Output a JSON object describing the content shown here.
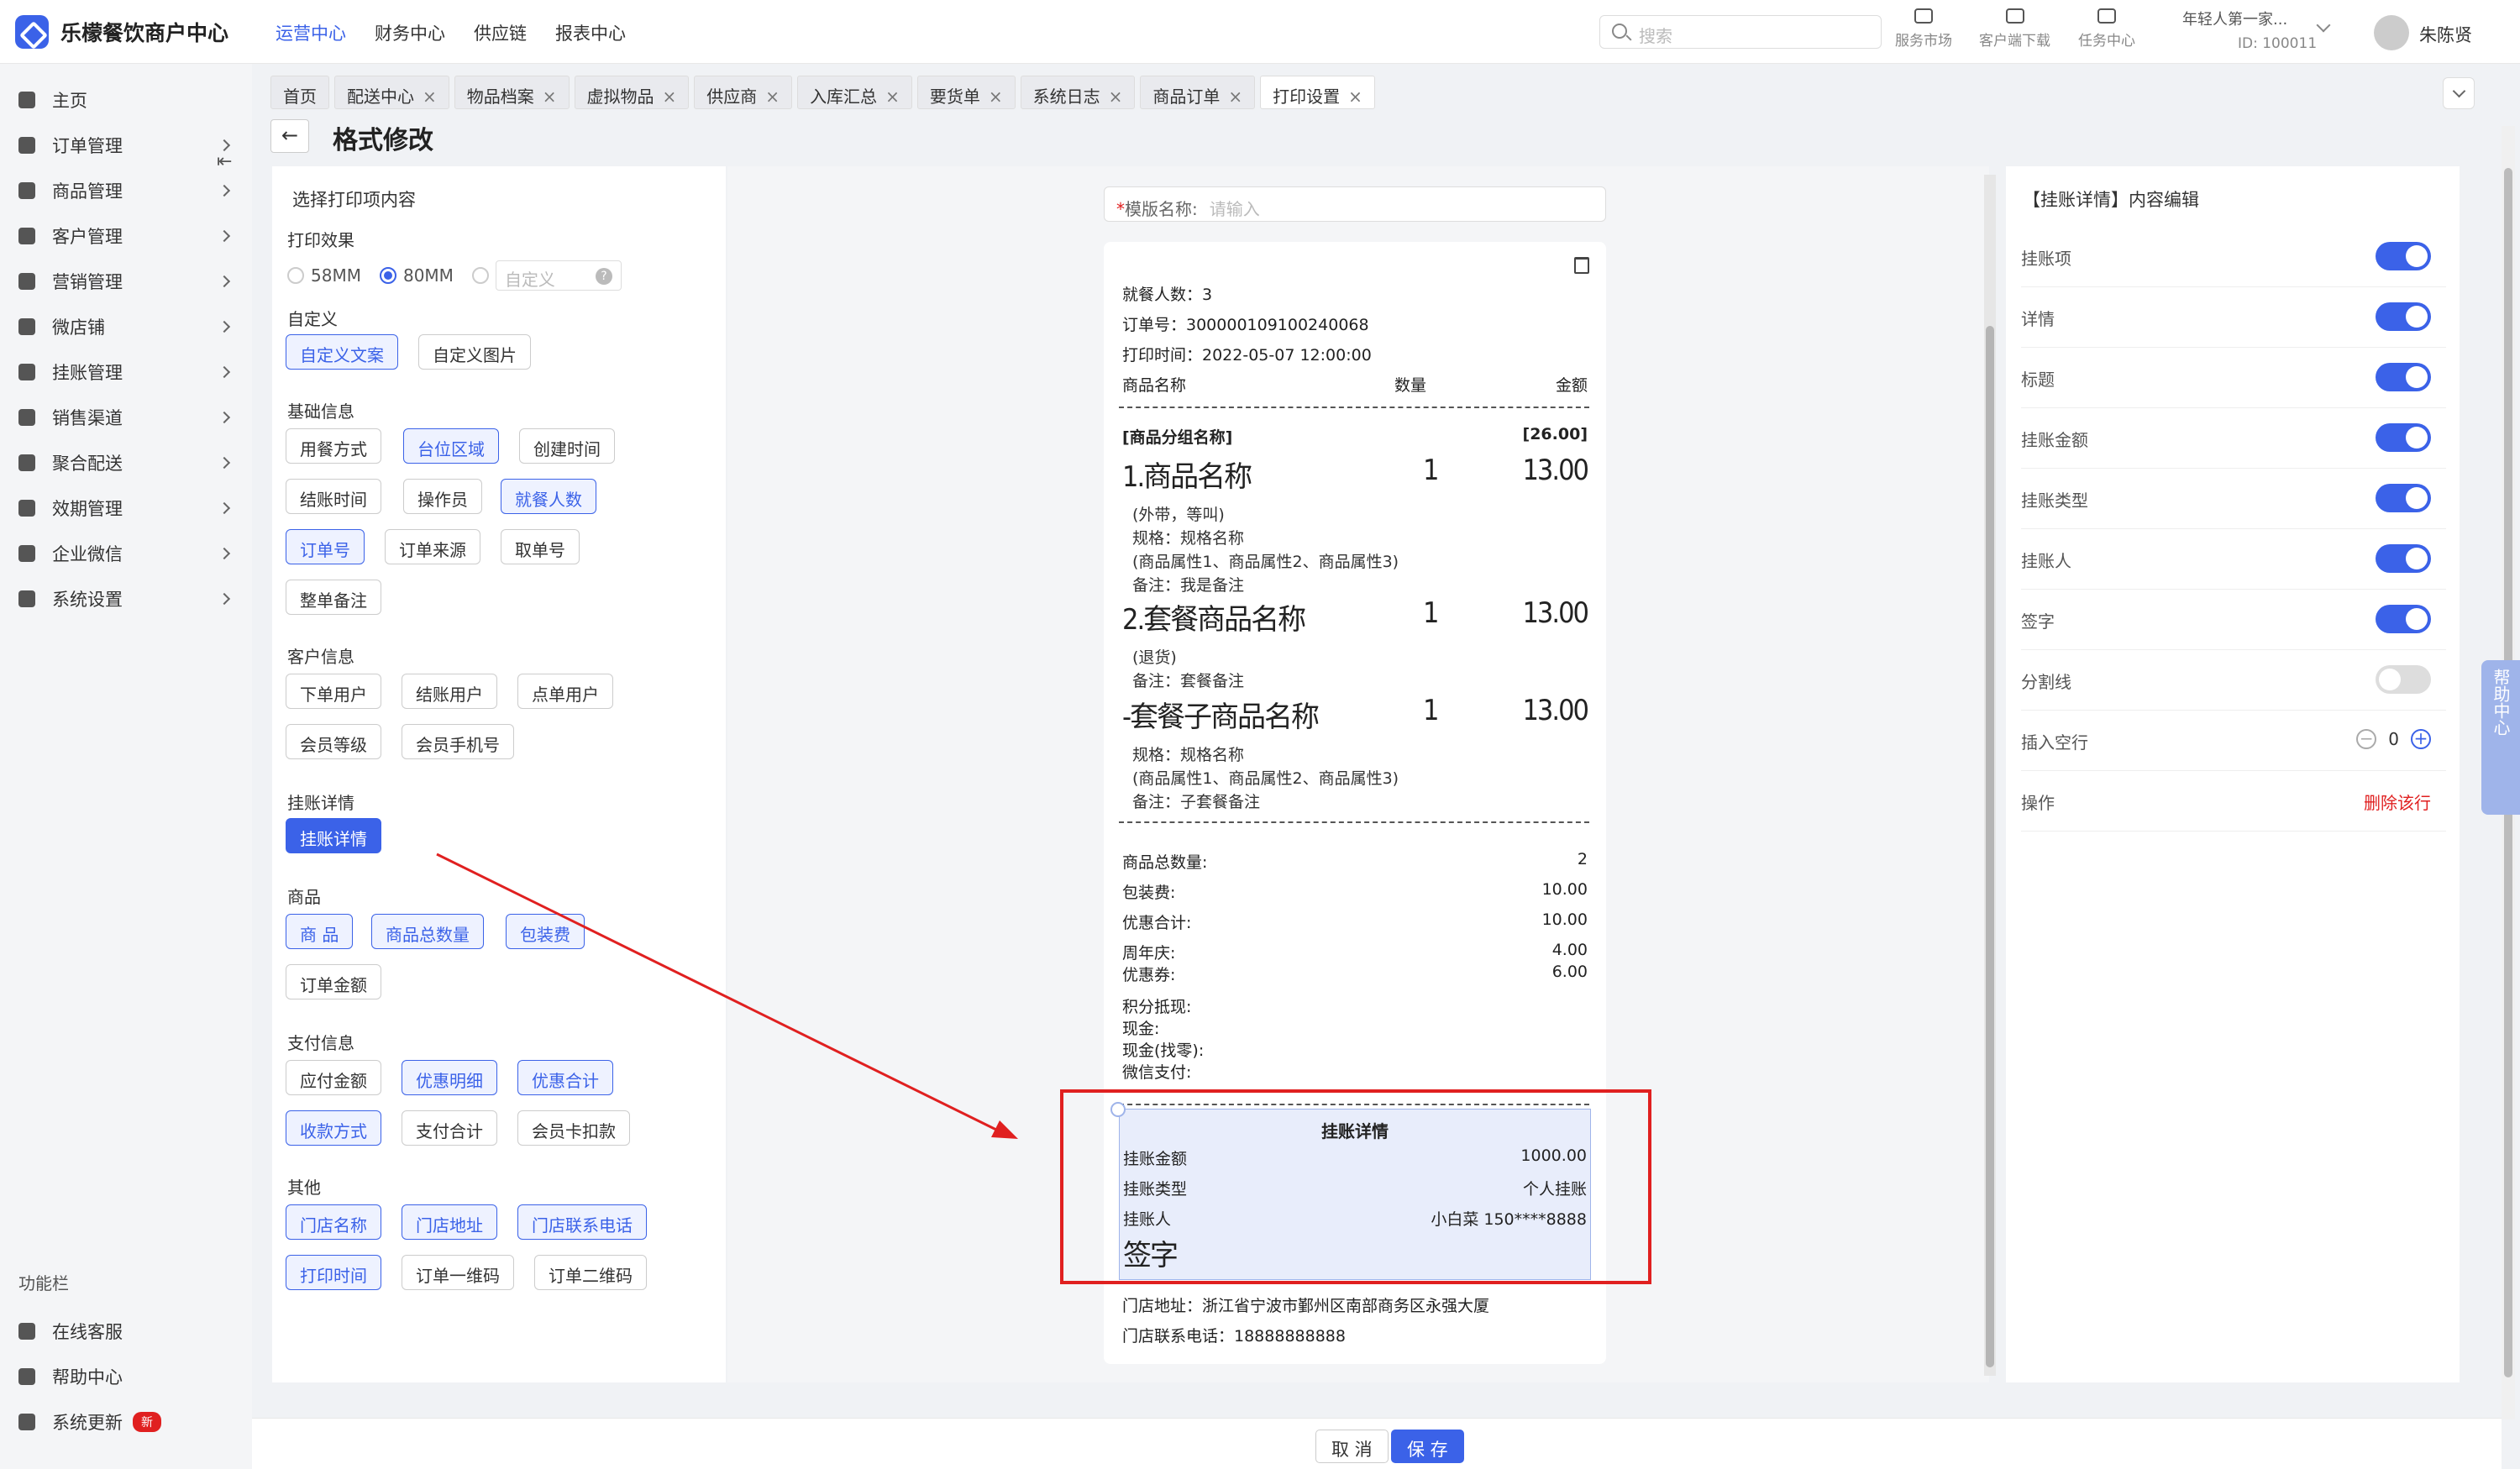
{
  "app": {
    "brand": "乐檬餐饮商户中心",
    "top_nav": [
      "运营中心",
      "财务中心",
      "供应链",
      "报表中心"
    ],
    "search_placeholder": "搜索",
    "tools": [
      "服务市场",
      "客户端下载",
      "任务中心"
    ],
    "tenant_name": "年轻人第一家...",
    "tenant_id": "ID: 100011",
    "user": "朱陈贤"
  },
  "sidebar": {
    "items": [
      "主页",
      "订单管理",
      "商品管理",
      "客户管理",
      "营销管理",
      "微店铺",
      "挂账管理",
      "销售渠道",
      "聚合配送",
      "效期管理",
      "企业微信",
      "系统设置"
    ],
    "fn_title": "功能栏",
    "fn_items": [
      "在线客服",
      "帮助中心",
      "系统更新"
    ],
    "new_badge": "新"
  },
  "tabs": [
    "首页",
    "配送中心",
    "物品档案",
    "虚拟物品",
    "供应商",
    "入库汇总",
    "要货单",
    "系统日志",
    "商品订单",
    "打印设置"
  ],
  "page": {
    "title": "格式修改",
    "back": "←"
  },
  "left": {
    "title": "选择打印项内容",
    "print_effect": "打印效果",
    "r58": "58MM",
    "r80": "80MM",
    "custom_input": "自定义",
    "sections": [
      {
        "label": "自定义",
        "chips": [
          "自定义文案",
          "自定义图片"
        ]
      },
      {
        "label": "基础信息",
        "chips": [
          "用餐方式",
          "台位区域",
          "创建时间",
          "结账时间",
          "操作员",
          "就餐人数",
          "订单号",
          "订单来源",
          "取单号",
          "整单备注"
        ]
      },
      {
        "label": "客户信息",
        "chips": [
          "下单用户",
          "结账用户",
          "点单用户",
          "会员等级",
          "会员手机号"
        ]
      },
      {
        "label": "挂账详情",
        "chips": [
          "挂账详情"
        ]
      },
      {
        "label": "商品",
        "chips": [
          "商 品",
          "商品总数量",
          "包装费",
          "订单金额"
        ]
      },
      {
        "label": "支付信息",
        "chips": [
          "应付金额",
          "优惠明细",
          "优惠合计",
          "收款方式",
          "支付合计",
          "会员卡扣款"
        ]
      },
      {
        "label": "其他",
        "chips": [
          "门店名称",
          "门店地址",
          "门店联系电话",
          "打印时间",
          "订单一维码",
          "订单二维码"
        ]
      }
    ]
  },
  "template": {
    "label": "模版名称:",
    "placeholder": "请输入"
  },
  "receipt": {
    "diners": "就餐人数：3",
    "order_no": "订单号：300000109100240068",
    "print_time": "打印时间：2022-05-07 12:00:00",
    "col_name": "商品名称",
    "col_qty": "数量",
    "col_amt": "金额",
    "group": "[商品分组名称]",
    "group_amt": "[26.00]",
    "items": [
      {
        "name": "1.商品名称",
        "qty": "1",
        "amt": "13.00",
        "lines": [
          "(外带，等叫)",
          "规格：规格名称",
          "(商品属性1、商品属性2、商品属性3)",
          "备注：我是备注"
        ]
      },
      {
        "name": "2.套餐商品名称",
        "qty": "1",
        "amt": "13.00",
        "lines": [
          "(退货)",
          "备注：套餐备注"
        ]
      },
      {
        "name": "-套餐子商品名称",
        "qty": "1",
        "amt": "13.00",
        "lines": [
          "规格：规格名称",
          "(商品属性1、商品属性2、商品属性3)",
          "备注：子套餐备注"
        ]
      }
    ],
    "totals": [
      {
        "label": "商品总数量:",
        "value": "2"
      },
      {
        "label": "包装费:",
        "value": "10.00"
      },
      {
        "label": "优惠合计:",
        "value": "10.00"
      },
      {
        "label": "周年庆:",
        "value": "4.00"
      },
      {
        "label": "优惠券:",
        "value": "6.00"
      },
      {
        "label": "积分抵现:",
        "value": ""
      },
      {
        "label": "现金:",
        "value": ""
      },
      {
        "label": "现金(找零):",
        "value": ""
      },
      {
        "label": "微信支付:",
        "value": ""
      }
    ],
    "credit": {
      "title": "挂账详情",
      "rows": [
        {
          "label": "挂账金额",
          "value": "1000.00"
        },
        {
          "label": "挂账类型",
          "value": "个人挂账"
        },
        {
          "label": "挂账人",
          "value": "小白菜 150****8888"
        }
      ],
      "signature": "签字"
    },
    "address": "门店地址：浙江省宁波市鄞州区南部商务区永强大厦",
    "phone": "门店联系电话：18888888888"
  },
  "right": {
    "title": "【挂账详情】内容编辑",
    "rows": [
      {
        "label": "挂账项",
        "on": true
      },
      {
        "label": "详情",
        "on": true
      },
      {
        "label": "标题",
        "on": true
      },
      {
        "label": "挂账金额",
        "on": true
      },
      {
        "label": "挂账类型",
        "on": true
      },
      {
        "label": "挂账人",
        "on": true
      },
      {
        "label": "签字",
        "on": true
      },
      {
        "label": "分割线",
        "on": false
      }
    ],
    "blank_label": "插入空行",
    "blank_value": "0",
    "op_label": "操作",
    "delete_label": "删除该行"
  },
  "help": "帮助中心",
  "footer": {
    "cancel": "取 消",
    "save": "保 存"
  },
  "colors": {
    "accent": "#3b62e8",
    "danger": "#e02020"
  }
}
